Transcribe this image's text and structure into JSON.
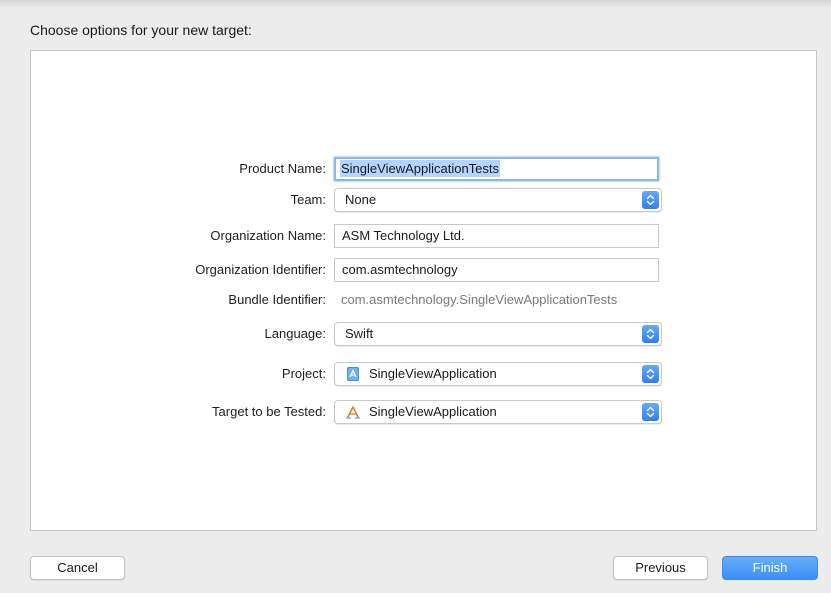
{
  "dialog": {
    "heading": "Choose options for your new target:"
  },
  "form": {
    "product_name": {
      "label": "Product Name:",
      "value": "SingleViewApplicationTests"
    },
    "team": {
      "label": "Team:",
      "value": "None"
    },
    "organization_name": {
      "label": "Organization Name:",
      "value": "ASM Technology Ltd."
    },
    "organization_identifier": {
      "label": "Organization Identifier:",
      "value": "com.asmtechnology"
    },
    "bundle_identifier": {
      "label": "Bundle Identifier:",
      "value": "com.asmtechnology.SingleViewApplicationTests"
    },
    "language": {
      "label": "Language:",
      "value": "Swift"
    },
    "project": {
      "label": "Project:",
      "value": "SingleViewApplication",
      "icon": "xcode-project-icon"
    },
    "target_to_be_tested": {
      "label": "Target to be Tested:",
      "value": "SingleViewApplication",
      "icon": "app-target-icon"
    }
  },
  "buttons": {
    "cancel": "Cancel",
    "previous": "Previous",
    "finish": "Finish"
  },
  "colors": {
    "accent": "#3b8ff5",
    "focus_ring": "#8ab8f0",
    "selection": "#b3d4fc"
  }
}
